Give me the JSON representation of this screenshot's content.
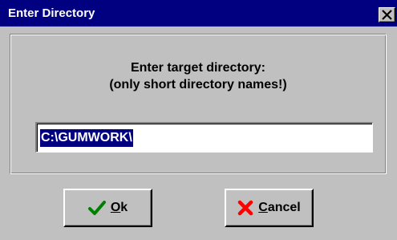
{
  "window": {
    "title": "Enter Directory",
    "close_icon": "close-x-icon"
  },
  "prompt": {
    "line1": "Enter target directory:",
    "line2": "(only short directory names!)"
  },
  "directory_input": {
    "value": "C:\\GUMWORK\\"
  },
  "buttons": {
    "ok": {
      "mnemonic": "O",
      "rest": "k",
      "icon": "checkmark-icon",
      "icon_color": "#008000"
    },
    "cancel": {
      "mnemonic": "C",
      "rest": "ancel",
      "icon": "x-cross-icon",
      "icon_color": "#ff0000"
    }
  },
  "colors": {
    "titlebar": "#000080",
    "face": "#c0c0c0",
    "selection": "#000080"
  }
}
